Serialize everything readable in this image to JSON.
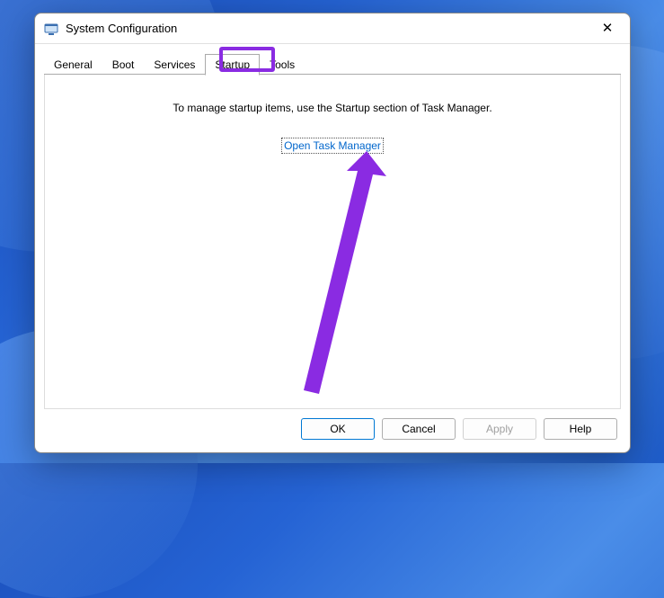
{
  "window": {
    "title": "System Configuration"
  },
  "tabs": {
    "items": [
      "General",
      "Boot",
      "Services",
      "Startup",
      "Tools"
    ],
    "active": "Startup"
  },
  "content": {
    "instruction": "To manage startup items, use the Startup section of Task Manager.",
    "link_label": "Open Task Manager"
  },
  "buttons": {
    "ok": "OK",
    "cancel": "Cancel",
    "apply": "Apply",
    "help": "Help"
  },
  "annotation": {
    "highlight_tab": "Startup",
    "arrow_color": "#8a2be2"
  }
}
